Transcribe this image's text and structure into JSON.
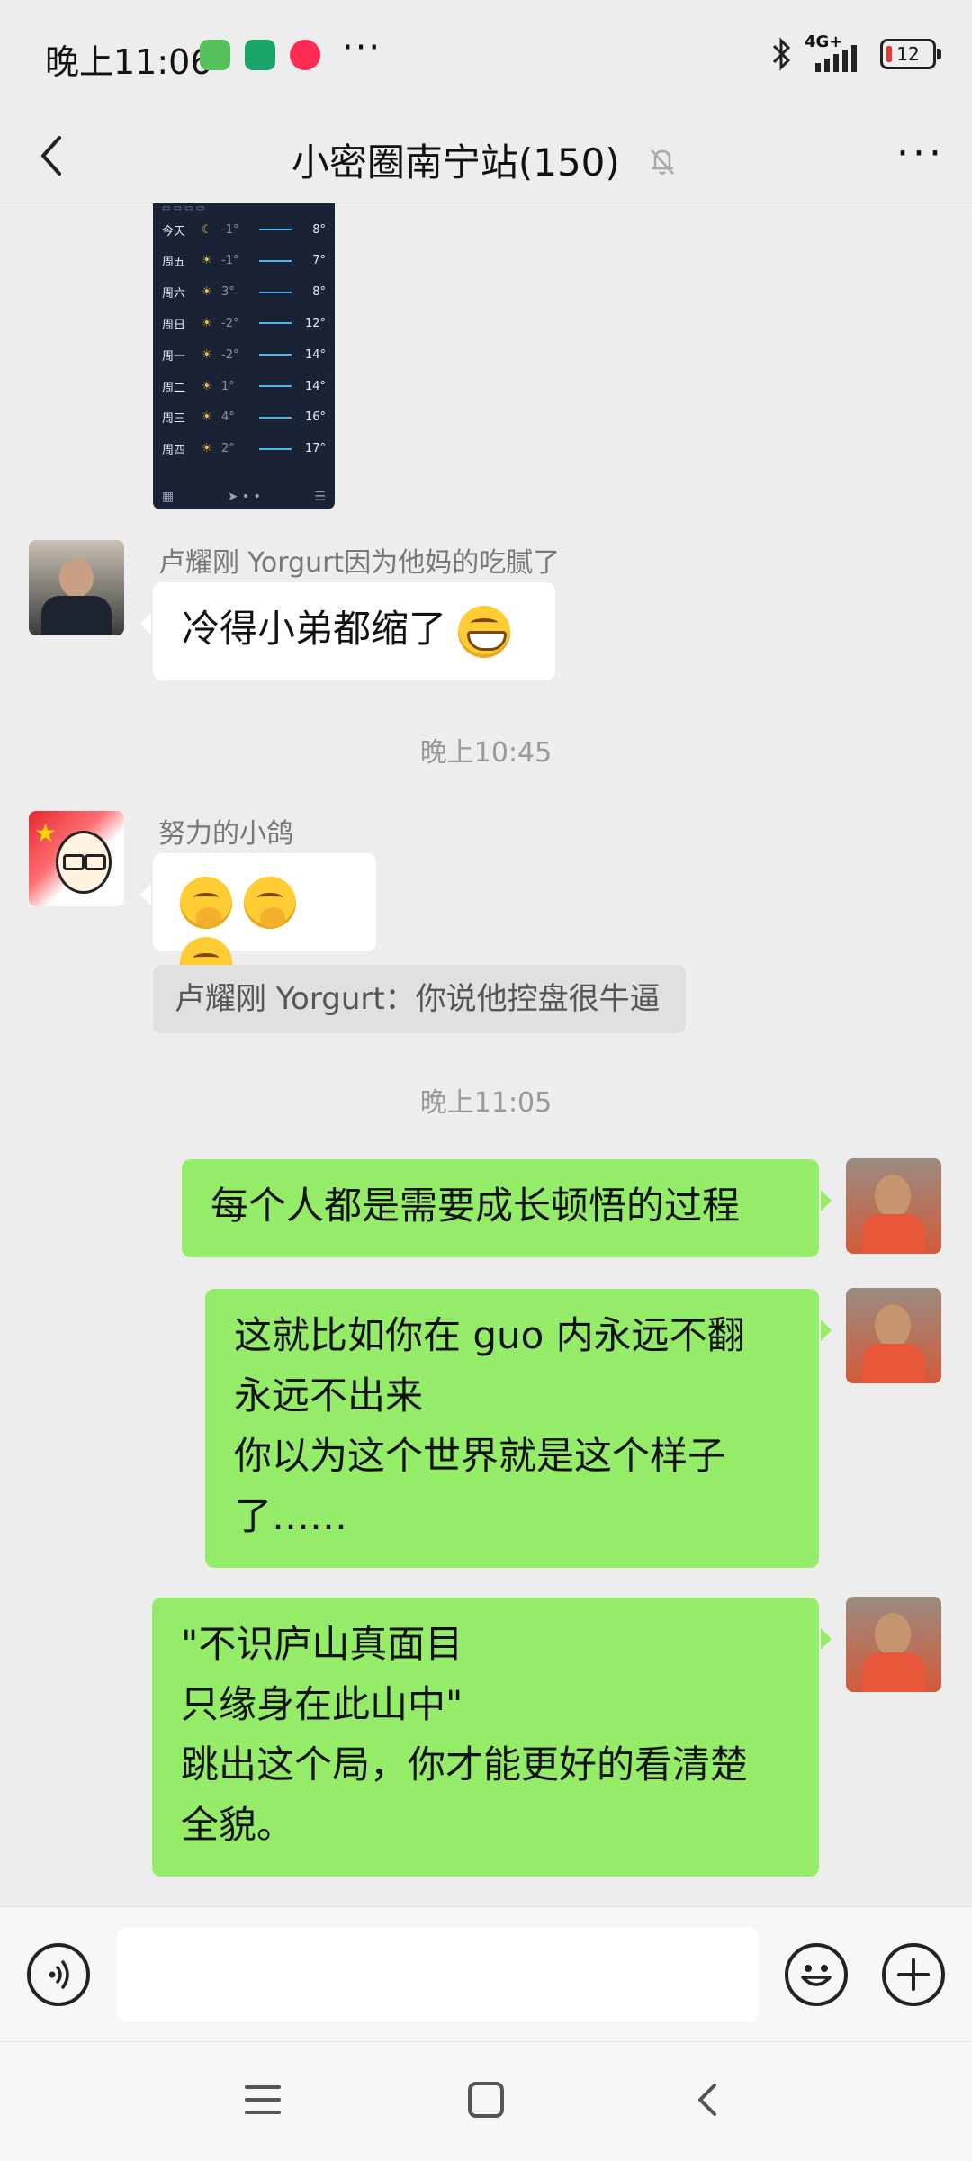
{
  "status_bar": {
    "time": "晚上11:06",
    "more": "···",
    "network": "4G+",
    "battery": "12",
    "battery_color": "#e53935"
  },
  "header": {
    "title": "小密圈南宁站(150)",
    "more": "···"
  },
  "weather_image": {
    "rows": [
      {
        "day": "今天",
        "icon": "☾",
        "low": "-1°",
        "high": "8°"
      },
      {
        "day": "周五",
        "icon": "☀",
        "low": "-1°",
        "high": "7°"
      },
      {
        "day": "周六",
        "icon": "☀",
        "low": "3°",
        "high": "8°"
      },
      {
        "day": "周日",
        "icon": "☀",
        "low": "-2°",
        "high": "12°"
      },
      {
        "day": "周一",
        "icon": "☀",
        "low": "-2°",
        "high": "14°"
      },
      {
        "day": "周二",
        "icon": "☀",
        "low": "1°",
        "high": "14°"
      },
      {
        "day": "周三",
        "icon": "☀",
        "low": "4°",
        "high": "16°"
      },
      {
        "day": "周四",
        "icon": "☀",
        "low": "2°",
        "high": "17°"
      }
    ]
  },
  "messages": {
    "m1": {
      "sender": "卢耀刚 Yorgurt因为他妈的吃腻了",
      "text": "冷得小弟都缩了"
    },
    "ts1": "晚上10:45",
    "m2": {
      "sender": "努力的小鸽"
    },
    "quote2": "卢耀刚 Yorgurt：你说他控盘很牛逼",
    "ts2": "晚上11:05",
    "m3": {
      "text": "每个人都是需要成长顿悟的过程"
    },
    "m4": {
      "lines": [
        "这就比如你在 guo 内永远不翻",
        "永远不出来",
        "你以为这个世界就是这个样子",
        "了……"
      ]
    },
    "m5": {
      "lines": [
        "\"不识庐山真面目",
        "只缘身在此山中\"",
        "跳出这个局，你才能更好的看清楚",
        "全貌。"
      ]
    }
  },
  "colors": {
    "outgoing_bubble": "#95ec69",
    "incoming_bubble": "#ffffff",
    "background": "#ededed"
  }
}
